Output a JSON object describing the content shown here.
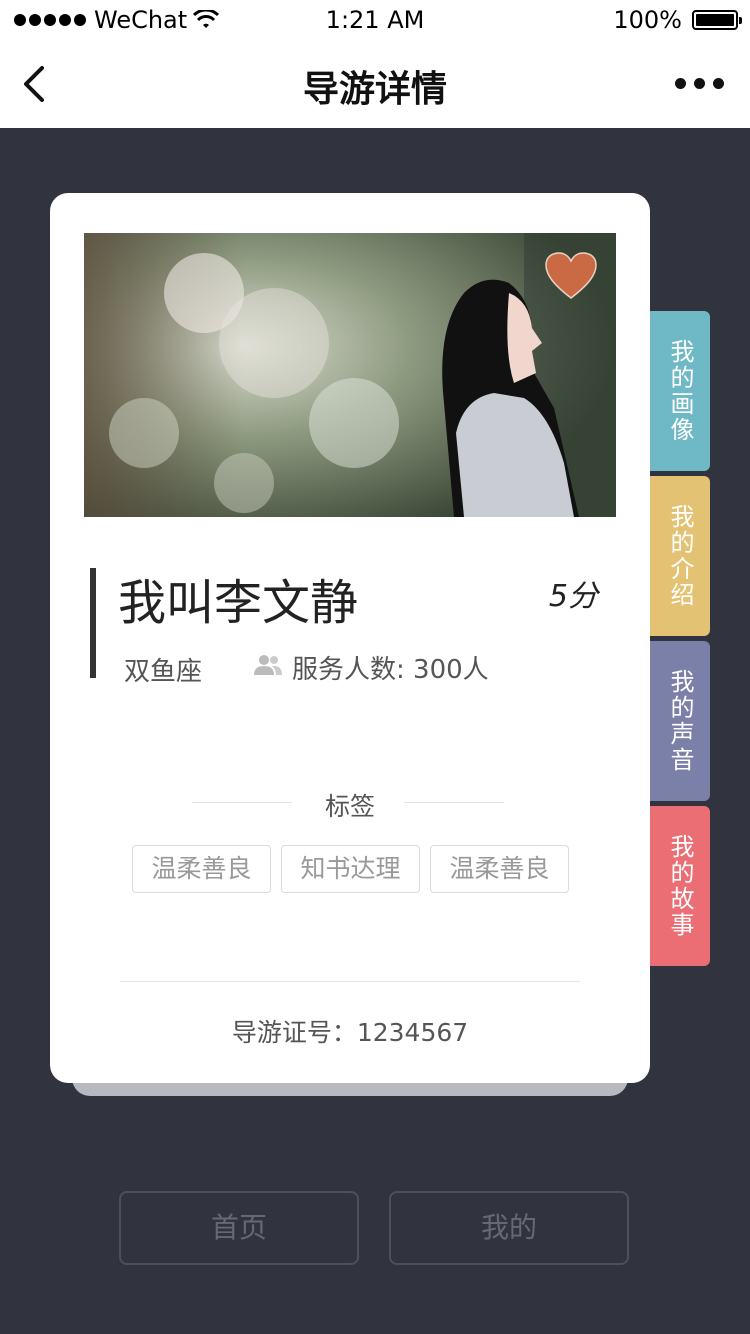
{
  "status_bar": {
    "carrier": "WeChat",
    "time": "1:21 AM",
    "battery": "100%"
  },
  "nav": {
    "title": "导游详情"
  },
  "card": {
    "name": "我叫李文静",
    "score": "5分",
    "zodiac": "双鱼座",
    "service": "服务人数: 300人",
    "tags_title": "标签",
    "tags": [
      "温柔善良",
      "知书达理",
      "温柔善良"
    ],
    "license": "导游证号：1234567"
  },
  "side_tabs": [
    {
      "label": "我的画像",
      "color": "#6fb9c6"
    },
    {
      "label": "我的介绍",
      "color": "#e4c274"
    },
    {
      "label": "我的声音",
      "color": "#7a80a8"
    },
    {
      "label": "我的故事",
      "color": "#ec6e75"
    }
  ],
  "bottom_nav": {
    "home": "首页",
    "mine": "我的"
  },
  "colors": {
    "background": "#31333e",
    "heart": "#c96a45"
  }
}
